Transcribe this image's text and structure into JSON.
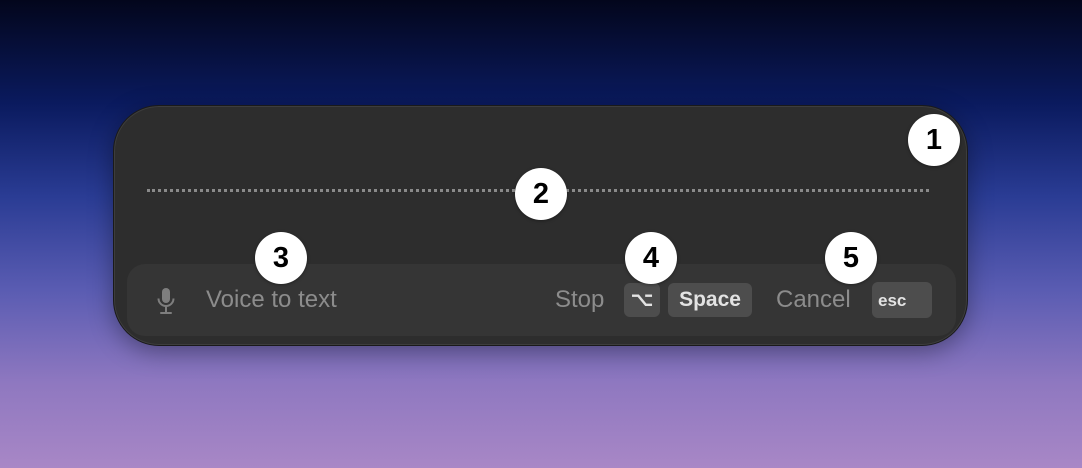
{
  "dictation_panel": {
    "input_hint": "Voice to text",
    "stop_label": "Stop",
    "stop_shortcut_modifier": "⌥",
    "stop_shortcut_key": "Space",
    "cancel_label": "Cancel",
    "cancel_shortcut_key": "esc",
    "mic_icon": "microphone-icon",
    "text_color": "#8c8c8c",
    "panel_color": "#2d2d2d",
    "key_color": "#4d4d4d"
  },
  "callouts": [
    "1",
    "2",
    "3",
    "4",
    "5"
  ]
}
